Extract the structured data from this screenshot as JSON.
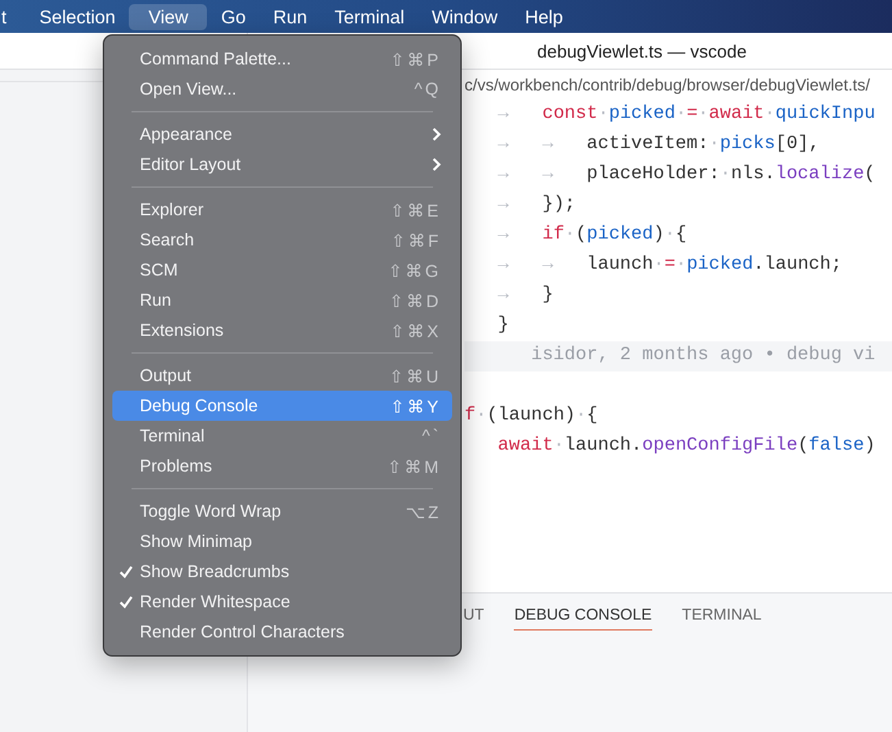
{
  "menubar": [
    {
      "label": "t",
      "selected": false
    },
    {
      "label": "Selection",
      "selected": false
    },
    {
      "label": "View",
      "selected": true
    },
    {
      "label": "Go",
      "selected": false
    },
    {
      "label": "Run",
      "selected": false
    },
    {
      "label": "Terminal",
      "selected": false
    },
    {
      "label": "Window",
      "selected": false
    },
    {
      "label": "Help",
      "selected": false
    }
  ],
  "window": {
    "title": "debugViewlet.ts — vscode"
  },
  "breadcrumb": "c/vs/workbench/contrib/debug/browser/debugViewlet.ts/",
  "code_lines": [
    {
      "kind": "code",
      "tokens": [
        {
          "kind": "whitespace",
          "text": "   →   "
        },
        {
          "kind": "keyword",
          "text": "const"
        },
        {
          "kind": "whitespace",
          "text": "·"
        },
        {
          "kind": "variable",
          "text": "picked"
        },
        {
          "kind": "whitespace",
          "text": "·"
        },
        {
          "kind": "keyword",
          "text": "="
        },
        {
          "kind": "whitespace",
          "text": "·"
        },
        {
          "kind": "keyword",
          "text": "await"
        },
        {
          "kind": "whitespace",
          "text": "·"
        },
        {
          "kind": "variable",
          "text": "quickInpu"
        }
      ]
    },
    {
      "kind": "code",
      "tokens": [
        {
          "kind": "whitespace",
          "text": "   →   →   "
        },
        {
          "kind": "plain",
          "text": "activeItem:"
        },
        {
          "kind": "whitespace",
          "text": "·"
        },
        {
          "kind": "variable",
          "text": "picks"
        },
        {
          "kind": "plain",
          "text": "[0],"
        }
      ]
    },
    {
      "kind": "code",
      "tokens": [
        {
          "kind": "whitespace",
          "text": "   →   →   "
        },
        {
          "kind": "plain",
          "text": "placeHolder:"
        },
        {
          "kind": "whitespace",
          "text": "·"
        },
        {
          "kind": "plain",
          "text": "nls."
        },
        {
          "kind": "function",
          "text": "localize"
        },
        {
          "kind": "plain",
          "text": "("
        }
      ]
    },
    {
      "kind": "code",
      "tokens": [
        {
          "kind": "whitespace",
          "text": "   →   "
        },
        {
          "kind": "plain",
          "text": "});"
        }
      ]
    },
    {
      "kind": "code",
      "tokens": [
        {
          "kind": "whitespace",
          "text": "   →   "
        },
        {
          "kind": "keyword",
          "text": "if"
        },
        {
          "kind": "whitespace",
          "text": "·"
        },
        {
          "kind": "plain",
          "text": "("
        },
        {
          "kind": "variable",
          "text": "picked"
        },
        {
          "kind": "plain",
          "text": ")"
        },
        {
          "kind": "whitespace",
          "text": "·"
        },
        {
          "kind": "plain",
          "text": "{"
        }
      ]
    },
    {
      "kind": "code",
      "tokens": [
        {
          "kind": "whitespace",
          "text": "   →   →   "
        },
        {
          "kind": "plain",
          "text": "launch"
        },
        {
          "kind": "whitespace",
          "text": "·"
        },
        {
          "kind": "keyword",
          "text": "="
        },
        {
          "kind": "whitespace",
          "text": "·"
        },
        {
          "kind": "variable",
          "text": "picked"
        },
        {
          "kind": "plain",
          "text": ".launch;"
        }
      ]
    },
    {
      "kind": "code",
      "tokens": [
        {
          "kind": "whitespace",
          "text": "   →   "
        },
        {
          "kind": "plain",
          "text": "}"
        }
      ]
    },
    {
      "kind": "code",
      "tokens": [
        {
          "kind": "plain",
          "text": "   }"
        }
      ]
    },
    {
      "kind": "blame",
      "tokens": [
        {
          "kind": "blame",
          "text": "      isidor, 2 months ago • debug vi"
        }
      ]
    },
    {
      "kind": "blank"
    },
    {
      "kind": "code",
      "tokens": [
        {
          "kind": "keyword",
          "text": "f"
        },
        {
          "kind": "whitespace",
          "text": "·"
        },
        {
          "kind": "plain",
          "text": "(launch)"
        },
        {
          "kind": "whitespace",
          "text": "·"
        },
        {
          "kind": "plain",
          "text": "{"
        }
      ]
    },
    {
      "kind": "code",
      "tokens": [
        {
          "kind": "keyword",
          "text": "   await"
        },
        {
          "kind": "whitespace",
          "text": "·"
        },
        {
          "kind": "plain",
          "text": "launch."
        },
        {
          "kind": "function",
          "text": "openConfigFile"
        },
        {
          "kind": "plain",
          "text": "("
        },
        {
          "kind": "variable",
          "text": "false"
        },
        {
          "kind": "plain",
          "text": ")"
        }
      ]
    }
  ],
  "panel_tabs": [
    {
      "label": "UT",
      "selected": false
    },
    {
      "label": "DEBUG CONSOLE",
      "selected": true
    },
    {
      "label": "TERMINAL",
      "selected": false
    }
  ],
  "menu": {
    "groups": [
      [
        {
          "label": "Command Palette...",
          "shortcut": "⇧⌘P",
          "submenu": false,
          "checked": false,
          "selected": false
        },
        {
          "label": "Open View...",
          "shortcut": "^Q",
          "submenu": false,
          "checked": false,
          "selected": false
        }
      ],
      [
        {
          "label": "Appearance",
          "submenu": true,
          "checked": false,
          "selected": false
        },
        {
          "label": "Editor Layout",
          "submenu": true,
          "checked": false,
          "selected": false
        }
      ],
      [
        {
          "label": "Explorer",
          "shortcut": "⇧⌘E",
          "submenu": false,
          "checked": false,
          "selected": false
        },
        {
          "label": "Search",
          "shortcut": "⇧⌘F",
          "submenu": false,
          "checked": false,
          "selected": false
        },
        {
          "label": "SCM",
          "shortcut": "⇧⌘G",
          "submenu": false,
          "checked": false,
          "selected": false
        },
        {
          "label": "Run",
          "shortcut": "⇧⌘D",
          "submenu": false,
          "checked": false,
          "selected": false
        },
        {
          "label": "Extensions",
          "shortcut": "⇧⌘X",
          "submenu": false,
          "checked": false,
          "selected": false
        }
      ],
      [
        {
          "label": "Output",
          "shortcut": "⇧⌘U",
          "submenu": false,
          "checked": false,
          "selected": false
        },
        {
          "label": "Debug Console",
          "shortcut": "⇧⌘Y",
          "submenu": false,
          "checked": false,
          "selected": true
        },
        {
          "label": "Terminal",
          "shortcut": "^`",
          "submenu": false,
          "checked": false,
          "selected": false
        },
        {
          "label": "Problems",
          "shortcut": "⇧⌘M",
          "submenu": false,
          "checked": false,
          "selected": false
        }
      ],
      [
        {
          "label": "Toggle Word Wrap",
          "shortcut": "⌥Z",
          "submenu": false,
          "checked": false,
          "selected": false
        },
        {
          "label": "Show Minimap",
          "submenu": false,
          "checked": false,
          "selected": false
        },
        {
          "label": "Show Breadcrumbs",
          "submenu": false,
          "checked": true,
          "selected": false
        },
        {
          "label": "Render Whitespace",
          "submenu": false,
          "checked": true,
          "selected": false
        },
        {
          "label": "Render Control Characters",
          "submenu": false,
          "checked": false,
          "selected": false
        }
      ]
    ]
  }
}
